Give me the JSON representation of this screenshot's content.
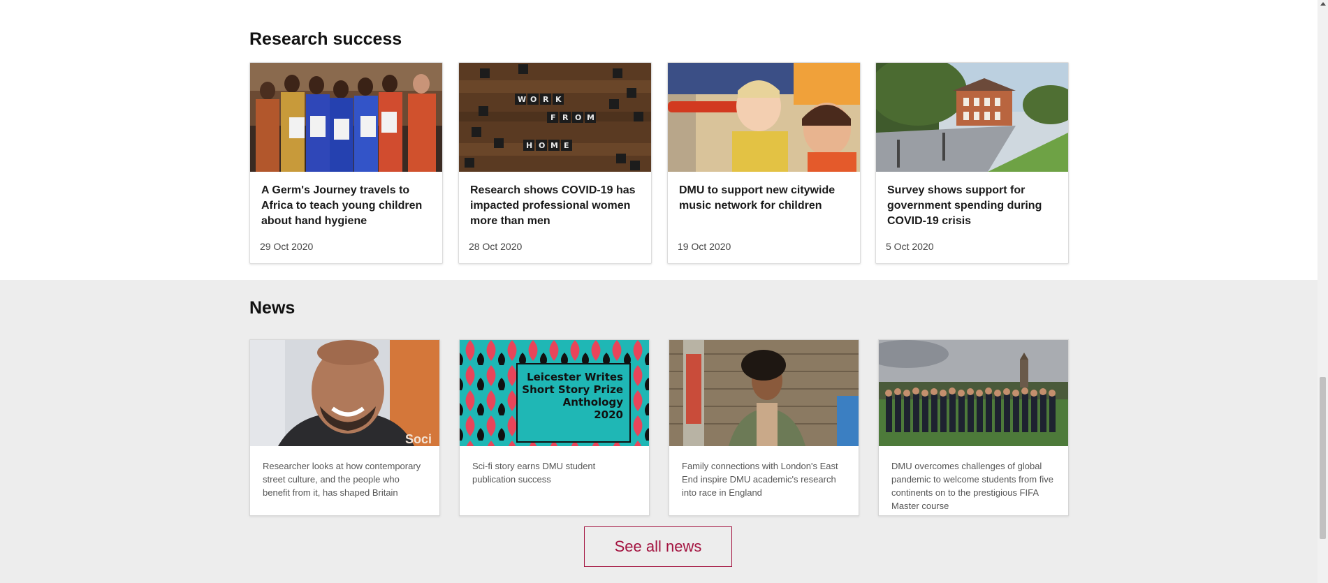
{
  "research": {
    "heading": "Research success",
    "cards": [
      {
        "title": "A Germ's Journey travels to Africa to teach young children about hand hygiene",
        "date": "29 Oct 2020",
        "image": "children-holding-leaflets-photo"
      },
      {
        "title": "Research shows COVID-19 has impacted professional women more than men",
        "date": "28 Oct 2020",
        "image": "work-from-home-letter-tiles-photo"
      },
      {
        "title": "DMU to support new citywide music network for children",
        "date": "19 Oct 2020",
        "image": "toddlers-playing-music-photo"
      },
      {
        "title": "Survey shows support for government spending during COVID-19 crisis",
        "date": "5 Oct 2020",
        "image": "brick-building-park-photo"
      }
    ]
  },
  "news": {
    "heading": "News",
    "cards": [
      {
        "text": "Researcher looks at how contemporary street culture, and the people who benefit from it, has shaped Britain",
        "image": "smiling-man-portrait-photo",
        "image_caption": "Soci"
      },
      {
        "text": "Sci-fi story earns DMU student publication success",
        "image": "anthology-cover-graphic",
        "cover_text": [
          "Leicester Writes",
          "Short Story Prize",
          "Anthology",
          "2020"
        ]
      },
      {
        "text": "Family connections with London's East End inspire DMU academic's research into race in England",
        "image": "woman-by-brick-wall-photo"
      },
      {
        "text": "DMU overcomes challenges of global pandemic to welcome students from five continents on to the prestigious FIFA Master course",
        "image": "student-group-on-field-photo"
      }
    ],
    "see_all_label": "See all news"
  },
  "colors": {
    "accent": "#a3123f",
    "news_background": "#ededed",
    "anthology_teal": "#1fb7b5",
    "anthology_red": "#e8455a"
  }
}
